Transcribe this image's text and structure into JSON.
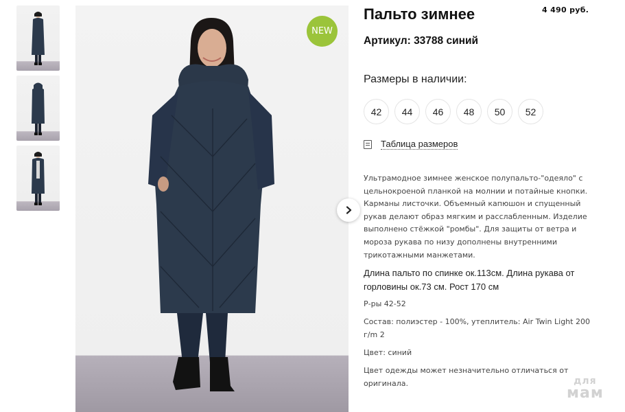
{
  "product": {
    "title": "Пальто зимнее",
    "price": "4 490 руб.",
    "article": "Артикул: 33788 синий",
    "badge": "NEW"
  },
  "sizes": {
    "label": "Размеры в наличии:",
    "items": [
      "42",
      "44",
      "46",
      "48",
      "50",
      "52"
    ]
  },
  "size_table_link": "Таблица размеров",
  "description": "Ультрамодное зимнее женское полупальто-\"одеяло\" с цельнокроеной планкой на молнии и потайные кнопки. Карманы листочки. Объемный капюшон и спущенный рукав делают образ мягким и расслабленным. Изделие выполнено стёжкой \"ромбы\". Для защиты от ветра и мороза рукава по низу дополнены внутренними трикотажными манжетами.",
  "length_info": "Длина пальто по спинке ок.113см. Длина рукава от горловины ок.73 см. Рост 170 см",
  "size_range": "Р-ры 42-52",
  "composition": "Состав: полиэстер - 100%, утеплитель: Air Twin Light 200 г/m 2",
  "color": "Цвет: синий",
  "color_note": "Цвет одежды может незначительно отличаться от оригинала.",
  "watermark": {
    "line1": "для",
    "line2": "мам"
  },
  "colors": {
    "badge": "#9bc43a",
    "coat": "#2c3a4c"
  },
  "icons": {
    "next": "chevron-right-icon",
    "size_table": "document-icon"
  }
}
